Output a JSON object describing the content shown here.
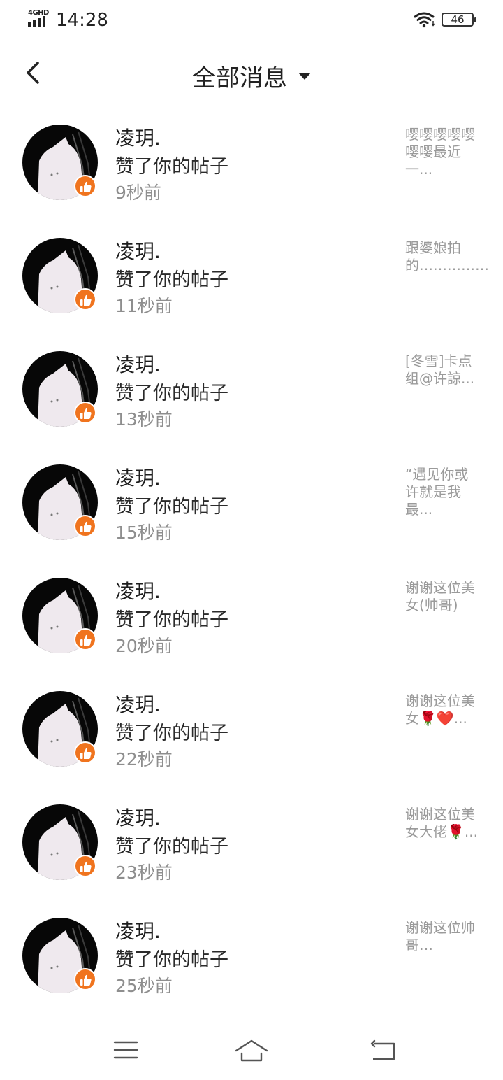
{
  "status_bar": {
    "network": "4GHD",
    "time": "14:28",
    "battery": "46"
  },
  "header": {
    "title": "全部消息"
  },
  "notifications": [
    {
      "name": "凌玥.",
      "action": "赞了你的帖子",
      "time": "9秒前",
      "preview": "嘤嘤嘤嘤嘤嘤嘤最近一..."
    },
    {
      "name": "凌玥.",
      "action": "赞了你的帖子",
      "time": "11秒前",
      "preview": "跟婆娘拍的……………"
    },
    {
      "name": "凌玥.",
      "action": "赞了你的帖子",
      "time": "13秒前",
      "preview": "[冬雪]卡点组@许諒..."
    },
    {
      "name": "凌玥.",
      "action": "赞了你的帖子",
      "time": "15秒前",
      "preview": "“遇见你或许就是我最..."
    },
    {
      "name": "凌玥.",
      "action": "赞了你的帖子",
      "time": "20秒前",
      "preview": "谢谢这位美女(帅哥)"
    },
    {
      "name": "凌玥.",
      "action": "赞了你的帖子",
      "time": "22秒前",
      "preview": "谢谢这位美女🌹❤️..."
    },
    {
      "name": "凌玥.",
      "action": "赞了你的帖子",
      "time": "23秒前",
      "preview": "谢谢这位美女大佬🌹..."
    },
    {
      "name": "凌玥.",
      "action": "赞了你的帖子",
      "time": "25秒前",
      "preview": "谢谢这位帅哥…"
    }
  ],
  "icons": {
    "back": "chevron-left-icon",
    "filter": "caret-down-icon",
    "like": "thumbs-up-icon",
    "menu": "menu-icon",
    "home": "home-icon",
    "return": "return-icon"
  },
  "colors": {
    "like_badge": "#f0741e",
    "muted_text": "#8e8e8e",
    "preview_text": "#9a9a9a"
  }
}
